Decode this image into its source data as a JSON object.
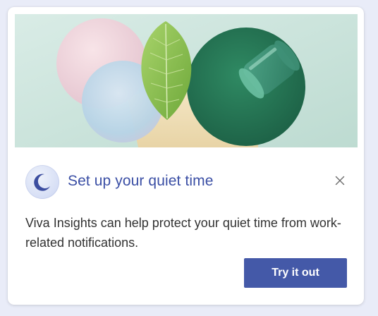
{
  "card": {
    "hero_image": "quiet-time-hero-image",
    "title": "Set up your quiet time",
    "description": "Viva Insights can help protect your quiet time from work-related notifications.",
    "primary_button_label": "Try it out",
    "app_icon": "moon-icon",
    "close_icon": "close-icon"
  },
  "colors": {
    "page_background": "#e9ecf8",
    "title": "#3b4fa5",
    "primary_button": "#4459a8",
    "body_text": "#323232"
  }
}
